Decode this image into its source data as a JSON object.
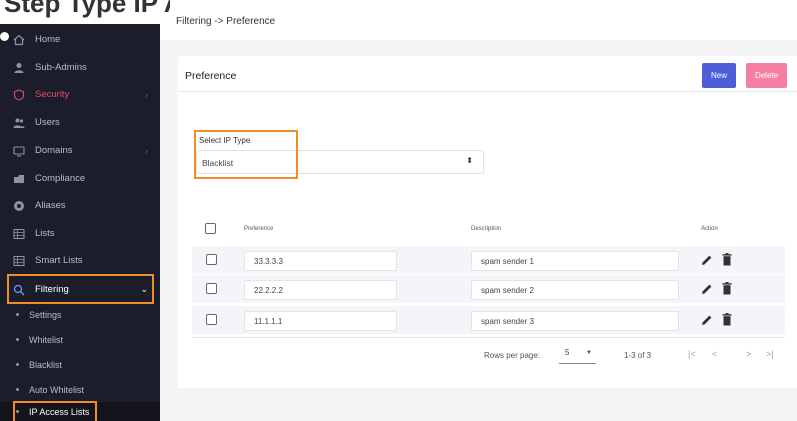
{
  "top_caption": "Step Type IP Access Type",
  "breadcrumb": "Filtering -> Preference",
  "sidebar": {
    "items": [
      {
        "label": "Home",
        "icon": "home-icon"
      },
      {
        "label": "Sub-Admins",
        "icon": "user-icon"
      },
      {
        "label": "Security",
        "icon": "shield-icon"
      },
      {
        "label": "Users",
        "icon": "users-icon"
      },
      {
        "label": "Domains",
        "icon": "monitor-icon"
      },
      {
        "label": "Compliance",
        "icon": "compliance-icon"
      },
      {
        "label": "Aliases",
        "icon": "alias-icon"
      },
      {
        "label": "Lists",
        "icon": "list-icon"
      },
      {
        "label": "Smart Lists",
        "icon": "smart-list-icon"
      },
      {
        "label": "Filtering",
        "icon": "search-icon"
      }
    ],
    "sub_items": [
      {
        "label": "Settings"
      },
      {
        "label": "Whitelist"
      },
      {
        "label": "Blacklist"
      },
      {
        "label": "Auto Whitelist"
      },
      {
        "label": "IP Access Lists"
      }
    ]
  },
  "card": {
    "title": "Preference",
    "new_label": "New",
    "delete_label": "Delete"
  },
  "select": {
    "label": "Select IP Type",
    "value": "Blacklist"
  },
  "table": {
    "headers": {
      "preference": "Preference",
      "description": "Description",
      "action": "Action"
    },
    "rows": [
      {
        "preference": "33.3.3.3",
        "description": "spam sender 1"
      },
      {
        "preference": "22.2.2.2",
        "description": "spam sender 2"
      },
      {
        "preference": "11.1.1.1",
        "description": "spam sender 3"
      }
    ]
  },
  "pagination": {
    "rows_per_page_label": "Rows per page:",
    "rows_per_page": "5",
    "range": "1-3 of 3",
    "first": "|<",
    "prev": "<",
    "next": ">",
    "last": ">|"
  },
  "colors": {
    "sidebar_bg": "#1c1d2b",
    "security_accent": "#e24a6c",
    "highlight_orange": "#f28c28",
    "new_button": "#4d5fd8",
    "delete_button": "#f47fa2"
  }
}
